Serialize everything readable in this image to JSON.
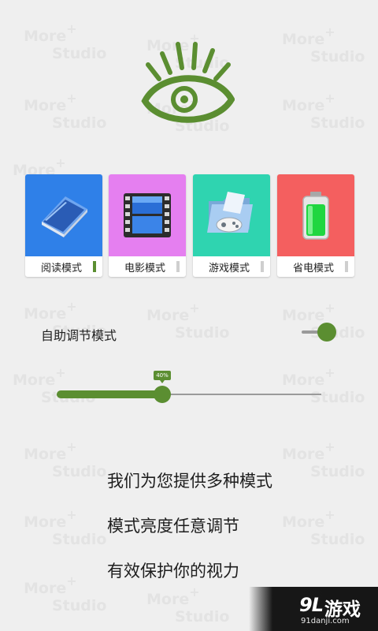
{
  "watermark": {
    "line1": "More",
    "plus": "+",
    "line2": "Studio"
  },
  "logo": {
    "icon": "eye-logo-icon",
    "color": "#5b8e31"
  },
  "modes": [
    {
      "label": "阅读模式",
      "icon": "book-icon",
      "color": "#2f80e8",
      "active": true
    },
    {
      "label": "电影模式",
      "icon": "film-icon",
      "color": "#e57ff0",
      "active": false
    },
    {
      "label": "游戏模式",
      "icon": "gamepad-folder-icon",
      "color": "#2fd4b0",
      "active": false
    },
    {
      "label": "省电模式",
      "icon": "battery-icon",
      "color": "#f45f5f",
      "active": false
    }
  ],
  "auto_adjust": {
    "label": "自助调节模式",
    "enabled": true
  },
  "brightness": {
    "value": 0.4,
    "label": "40%"
  },
  "promo": {
    "line1": "我们为您提供多种模式",
    "line2": "模式亮度任意调节",
    "line3": "有效保护你的视力"
  },
  "brand": {
    "mark": "9L",
    "name": "游戏",
    "url": "91danji.com"
  },
  "colors": {
    "accent": "#5b8e31",
    "background": "#efefef"
  }
}
